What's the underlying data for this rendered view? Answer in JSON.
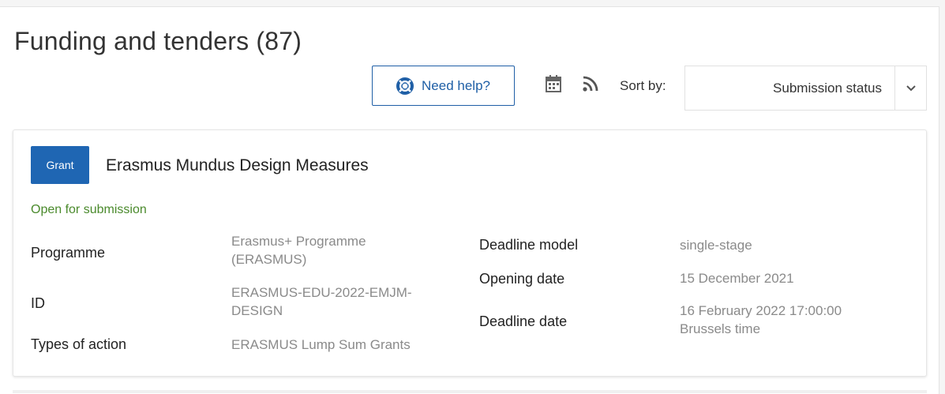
{
  "header": {
    "title": "Funding and tenders (87)",
    "help_label": "Need help?",
    "sort_label": "Sort by:",
    "sort_value": "Submission status",
    "icons": [
      "help-icon",
      "calendar-icon",
      "rss-icon",
      "chevron-down-icon"
    ]
  },
  "card": {
    "badge": "Grant",
    "title": "Erasmus Mundus Design Measures",
    "status": "Open for submission",
    "left_fields": {
      "programme_label": "Programme",
      "programme_value_line1": "Erasmus+ Programme",
      "programme_value_line2": "(ERASMUS)",
      "id_label": "ID",
      "id_value_line1": "ERASMUS-EDU-2022-EMJM-",
      "id_value_line2": "DESIGN",
      "types_label": "Types of action",
      "types_value": "ERASMUS Lump Sum Grants"
    },
    "right_fields": {
      "deadline_model_label": "Deadline model",
      "deadline_model_value": "single-stage",
      "opening_date_label": "Opening date",
      "opening_date_value": "15 December 2021",
      "deadline_date_label": "Deadline date",
      "deadline_date_value_line1": "16 February 2022 17:00:00",
      "deadline_date_value_line2": "Brussels time"
    }
  },
  "colors": {
    "accent": "#1f66b3",
    "status_green": "#4a8a2c"
  }
}
